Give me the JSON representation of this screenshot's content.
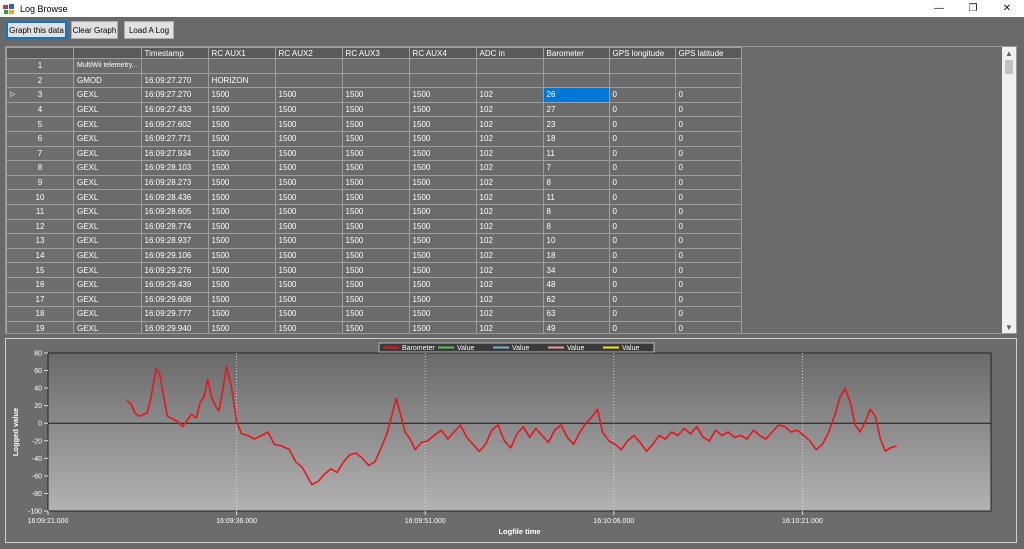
{
  "window": {
    "title": "Log Browse",
    "controls": [
      "minimize-icon",
      "restore-icon",
      "close-icon"
    ],
    "glyphs": {
      "minimize": "—",
      "restore": "❐",
      "close": "✕"
    }
  },
  "toolbar": {
    "graph_label": "Graph this data",
    "clear_label": "Clear Graph",
    "load_label": "Load A Log"
  },
  "grid": {
    "columns": [
      "",
      "",
      "Timestamp",
      "RC AUX1",
      "RC AUX2",
      "RC AUX3",
      "RC AUX4",
      "ADC in",
      "Barometer",
      "GPS longitude",
      "GPS latitude",
      ""
    ],
    "current_row_marker": "▷",
    "selected": {
      "row": 2,
      "col": 8
    },
    "rows": [
      [
        "1",
        "MultiWii telemetry...",
        "",
        "",
        "",
        "",
        "",
        "",
        "",
        "",
        "",
        ""
      ],
      [
        "2",
        "GMOD",
        "16:09:27.270",
        "HORIZON",
        "",
        "",
        "",
        "",
        "",
        "",
        "",
        ""
      ],
      [
        "3",
        "GEXL",
        "16:09:27.270",
        "1500",
        "1500",
        "1500",
        "1500",
        "102",
        "26",
        "0",
        "0",
        ""
      ],
      [
        "4",
        "GEXL",
        "16:09:27.433",
        "1500",
        "1500",
        "1500",
        "1500",
        "102",
        "27",
        "0",
        "0",
        ""
      ],
      [
        "5",
        "GEXL",
        "16:09:27.602",
        "1500",
        "1500",
        "1500",
        "1500",
        "102",
        "23",
        "0",
        "0",
        ""
      ],
      [
        "6",
        "GEXL",
        "16:09:27.771",
        "1500",
        "1500",
        "1500",
        "1500",
        "102",
        "18",
        "0",
        "0",
        ""
      ],
      [
        "7",
        "GEXL",
        "16:09:27.934",
        "1500",
        "1500",
        "1500",
        "1500",
        "102",
        "11",
        "0",
        "0",
        ""
      ],
      [
        "8",
        "GEXL",
        "16:09:28.103",
        "1500",
        "1500",
        "1500",
        "1500",
        "102",
        "7",
        "0",
        "0",
        ""
      ],
      [
        "9",
        "GEXL",
        "16:09:28.273",
        "1500",
        "1500",
        "1500",
        "1500",
        "102",
        "8",
        "0",
        "0",
        ""
      ],
      [
        "10",
        "GEXL",
        "16:09:28.436",
        "1500",
        "1500",
        "1500",
        "1500",
        "102",
        "11",
        "0",
        "0",
        ""
      ],
      [
        "11",
        "GEXL",
        "16:09:28.605",
        "1500",
        "1500",
        "1500",
        "1500",
        "102",
        "8",
        "0",
        "0",
        ""
      ],
      [
        "12",
        "GEXL",
        "16:09:28.774",
        "1500",
        "1500",
        "1500",
        "1500",
        "102",
        "8",
        "0",
        "0",
        ""
      ],
      [
        "13",
        "GEXL",
        "16:09:28.937",
        "1500",
        "1500",
        "1500",
        "1500",
        "102",
        "10",
        "0",
        "0",
        ""
      ],
      [
        "14",
        "GEXL",
        "16:09:29.106",
        "1500",
        "1500",
        "1500",
        "1500",
        "102",
        "18",
        "0",
        "0",
        ""
      ],
      [
        "15",
        "GEXL",
        "16:09:29.276",
        "1500",
        "1500",
        "1500",
        "1500",
        "102",
        "34",
        "0",
        "0",
        ""
      ],
      [
        "16",
        "GEXL",
        "16:09:29.439",
        "1500",
        "1500",
        "1500",
        "1500",
        "102",
        "48",
        "0",
        "0",
        ""
      ],
      [
        "17",
        "GEXL",
        "16:09:29.608",
        "1500",
        "1500",
        "1500",
        "1500",
        "102",
        "62",
        "0",
        "0",
        ""
      ],
      [
        "18",
        "GEXL",
        "16:09:29.777",
        "1500",
        "1500",
        "1500",
        "1500",
        "102",
        "63",
        "0",
        "0",
        ""
      ],
      [
        "19",
        "GEXL",
        "16:09:29.940",
        "1500",
        "1500",
        "1500",
        "1500",
        "102",
        "49",
        "0",
        "0",
        ""
      ]
    ]
  },
  "chart_data": {
    "type": "line",
    "title": "",
    "xlabel": "Logfile time",
    "ylabel": "Logged value",
    "x_range": [
      "16:09:21.000",
      "16:10:36.000"
    ],
    "ylim": [
      -100,
      80
    ],
    "y_ticks": [
      -100,
      -80,
      -60,
      -40,
      -20,
      0,
      20,
      40,
      60,
      80
    ],
    "x_ticks": [
      "16:09:21.000",
      "16:09:36.000",
      "16:09:51.000",
      "16:10:06.000",
      "16:10:21.000"
    ],
    "grid": "vertical dotted",
    "legend_position": "top",
    "series": [
      {
        "name": "Barometer",
        "color": "#e8151b",
        "points": [
          [
            "16:09:27.270",
            26
          ],
          [
            "16:09:27.600",
            22
          ],
          [
            "16:09:27.900",
            12
          ],
          [
            "16:09:28.200",
            8
          ],
          [
            "16:09:28.600",
            10
          ],
          [
            "16:09:28.900",
            12
          ],
          [
            "16:09:29.200",
            30
          ],
          [
            "16:09:29.600",
            62
          ],
          [
            "16:09:29.900",
            55
          ],
          [
            "16:09:30.200",
            30
          ],
          [
            "16:09:30.500",
            8
          ],
          [
            "16:09:30.900",
            5
          ],
          [
            "16:09:31.300",
            2
          ],
          [
            "16:09:31.700",
            -4
          ],
          [
            "16:09:32.000",
            2
          ],
          [
            "16:09:32.400",
            10
          ],
          [
            "16:09:32.800",
            6
          ],
          [
            "16:09:33.100",
            24
          ],
          [
            "16:09:33.400",
            30
          ],
          [
            "16:09:33.700",
            50
          ],
          [
            "16:09:34.000",
            30
          ],
          [
            "16:09:34.300",
            20
          ],
          [
            "16:09:34.600",
            14
          ],
          [
            "16:09:34.900",
            38
          ],
          [
            "16:09:35.200",
            65
          ],
          [
            "16:09:35.600",
            40
          ],
          [
            "16:09:36.000",
            2
          ],
          [
            "16:09:36.400",
            -12
          ],
          [
            "16:09:36.900",
            -14
          ],
          [
            "16:09:37.400",
            -18
          ],
          [
            "16:09:38.000",
            -14
          ],
          [
            "16:09:38.500",
            -10
          ],
          [
            "16:09:39.000",
            -24
          ],
          [
            "16:09:39.600",
            -26
          ],
          [
            "16:09:40.200",
            -30
          ],
          [
            "16:09:40.700",
            -44
          ],
          [
            "16:09:41.200",
            -50
          ],
          [
            "16:09:41.600",
            -60
          ],
          [
            "16:09:42.000",
            -70
          ],
          [
            "16:09:42.500",
            -66
          ],
          [
            "16:09:43.000",
            -58
          ],
          [
            "16:09:43.500",
            -52
          ],
          [
            "16:09:44.000",
            -56
          ],
          [
            "16:09:44.500",
            -44
          ],
          [
            "16:09:45.000",
            -36
          ],
          [
            "16:09:45.500",
            -34
          ],
          [
            "16:09:46.000",
            -40
          ],
          [
            "16:09:46.500",
            -48
          ],
          [
            "16:09:47.000",
            -44
          ],
          [
            "16:09:47.500",
            -28
          ],
          [
            "16:09:48.000",
            -10
          ],
          [
            "16:09:48.400",
            12
          ],
          [
            "16:09:48.700",
            28
          ],
          [
            "16:09:49.000",
            12
          ],
          [
            "16:09:49.400",
            -10
          ],
          [
            "16:09:49.800",
            -18
          ],
          [
            "16:09:50.200",
            -30
          ],
          [
            "16:09:50.700",
            -22
          ],
          [
            "16:09:51.200",
            -20
          ],
          [
            "16:09:51.700",
            -14
          ],
          [
            "16:09:52.300",
            -8
          ],
          [
            "16:09:52.800",
            -18
          ],
          [
            "16:09:53.300",
            -10
          ],
          [
            "16:09:53.800",
            -2
          ],
          [
            "16:09:54.300",
            -16
          ],
          [
            "16:09:54.800",
            -24
          ],
          [
            "16:09:55.300",
            -32
          ],
          [
            "16:09:55.800",
            -24
          ],
          [
            "16:09:56.300",
            -8
          ],
          [
            "16:09:56.800",
            -2
          ],
          [
            "16:09:57.300",
            -20
          ],
          [
            "16:09:57.800",
            -28
          ],
          [
            "16:09:58.300",
            -12
          ],
          [
            "16:09:58.800",
            -4
          ],
          [
            "16:09:59.300",
            -16
          ],
          [
            "16:09:59.800",
            -6
          ],
          [
            "16:10:00.300",
            -14
          ],
          [
            "16:10:00.800",
            -22
          ],
          [
            "16:10:01.300",
            -8
          ],
          [
            "16:10:01.800",
            -2
          ],
          [
            "16:10:02.300",
            -16
          ],
          [
            "16:10:02.800",
            -24
          ],
          [
            "16:10:03.300",
            -10
          ],
          [
            "16:10:03.800",
            0
          ],
          [
            "16:10:04.300",
            8
          ],
          [
            "16:10:04.700",
            16
          ],
          [
            "16:10:05.100",
            -10
          ],
          [
            "16:10:05.600",
            -20
          ],
          [
            "16:10:06.100",
            -24
          ],
          [
            "16:10:06.600",
            -30
          ],
          [
            "16:10:07.100",
            -20
          ],
          [
            "16:10:07.600",
            -14
          ],
          [
            "16:10:08.100",
            -22
          ],
          [
            "16:10:08.600",
            -32
          ],
          [
            "16:10:09.100",
            -24
          ],
          [
            "16:10:09.600",
            -14
          ],
          [
            "16:10:10.100",
            -18
          ],
          [
            "16:10:10.600",
            -10
          ],
          [
            "16:10:11.100",
            -14
          ],
          [
            "16:10:11.600",
            -6
          ],
          [
            "16:10:12.100",
            -12
          ],
          [
            "16:10:12.600",
            -4
          ],
          [
            "16:10:13.100",
            -16
          ],
          [
            "16:10:13.600",
            -20
          ],
          [
            "16:10:14.100",
            -8
          ],
          [
            "16:10:14.600",
            -14
          ],
          [
            "16:10:15.100",
            -10
          ],
          [
            "16:10:15.600",
            -16
          ],
          [
            "16:10:16.100",
            -14
          ],
          [
            "16:10:16.600",
            -18
          ],
          [
            "16:10:17.100",
            -8
          ],
          [
            "16:10:17.600",
            -14
          ],
          [
            "16:10:18.100",
            -18
          ],
          [
            "16:10:18.600",
            -10
          ],
          [
            "16:10:19.100",
            -2
          ],
          [
            "16:10:19.600",
            -4
          ],
          [
            "16:10:20.100",
            -10
          ],
          [
            "16:10:20.600",
            -8
          ],
          [
            "16:10:21.100",
            -14
          ],
          [
            "16:10:21.600",
            -20
          ],
          [
            "16:10:22.100",
            -30
          ],
          [
            "16:10:22.600",
            -24
          ],
          [
            "16:10:23.100",
            -10
          ],
          [
            "16:10:23.600",
            10
          ],
          [
            "16:10:24.000",
            30
          ],
          [
            "16:10:24.400",
            40
          ],
          [
            "16:10:24.800",
            24
          ],
          [
            "16:10:25.200",
            -2
          ],
          [
            "16:10:25.600",
            -10
          ],
          [
            "16:10:26.000",
            2
          ],
          [
            "16:10:26.400",
            16
          ],
          [
            "16:10:26.800",
            8
          ],
          [
            "16:10:27.200",
            -18
          ],
          [
            "16:10:27.600",
            -32
          ],
          [
            "16:10:28.000",
            -28
          ],
          [
            "16:10:28.500",
            -26
          ]
        ]
      },
      {
        "name": "Value",
        "color": "#5fbf5f",
        "points": []
      },
      {
        "name": "Value",
        "color": "#7fb3c9",
        "points": []
      },
      {
        "name": "Value",
        "color": "#e3a0a0",
        "points": []
      },
      {
        "name": "Value",
        "color": "#e8e820",
        "points": []
      }
    ]
  }
}
